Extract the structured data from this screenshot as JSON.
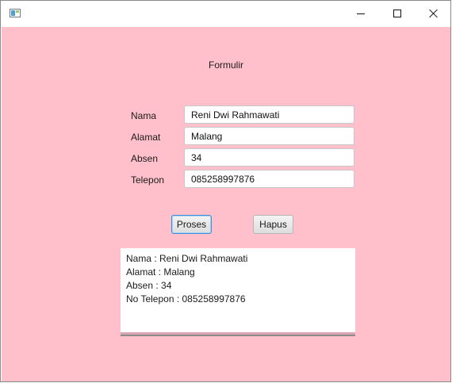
{
  "window": {
    "title": "",
    "controls": {
      "minimize": "minimize",
      "maximize": "maximize",
      "close": "close"
    }
  },
  "colors": {
    "background": "#ffc0cb",
    "focus": "#3a8fd8"
  },
  "form": {
    "title": "Formulir",
    "fields": [
      {
        "label": "Nama",
        "value": "Reni Dwi Rahmawati"
      },
      {
        "label": "Alamat",
        "value": "Malang"
      },
      {
        "label": "Absen",
        "value": "34"
      },
      {
        "label": "Telepon",
        "value": "085258997876"
      }
    ]
  },
  "buttons": {
    "proses": "Proses",
    "hapus": "Hapus"
  },
  "output": {
    "lines": [
      "Nama : Reni Dwi Rahmawati",
      "Alamat : Malang",
      "Absen : 34",
      "No Telepon : 085258997876"
    ]
  }
}
